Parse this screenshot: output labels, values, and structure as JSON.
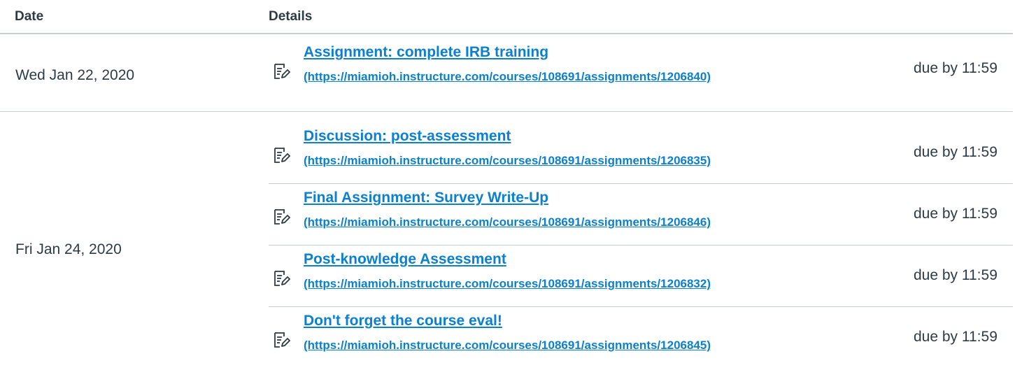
{
  "table": {
    "headers": {
      "date": "Date",
      "details": "Details"
    },
    "groups": [
      {
        "date": "Wed Jan 22, 2020",
        "items": [
          {
            "title": "Assignment: complete IRB training",
            "url": "(https://miamioh.instructure.com/courses/108691/assignments/1206840)",
            "due": "due by 11:59"
          }
        ]
      },
      {
        "date": "Fri Jan 24, 2020",
        "items": [
          {
            "title": "Discussion: post-assessment",
            "url": "(https://miamioh.instructure.com/courses/108691/assignments/1206835)",
            "due": "due by 11:59"
          },
          {
            "title": "Final Assignment: Survey Write-Up",
            "url": "(https://miamioh.instructure.com/courses/108691/assignments/1206846)",
            "due": "due by 11:59"
          },
          {
            "title": "Post-knowledge Assessment",
            "url": "(https://miamioh.instructure.com/courses/108691/assignments/1206832)",
            "due": "due by 11:59"
          },
          {
            "title": "Don't forget the course eval!",
            "url": "(https://miamioh.instructure.com/courses/108691/assignments/1206845)",
            "due": "due by 11:59"
          }
        ]
      }
    ]
  },
  "icons": {
    "item_icon": "assignment-icon"
  },
  "colors": {
    "link": "#0b80cf",
    "text": "#2d3b45",
    "divider": "#c7cdd1"
  }
}
